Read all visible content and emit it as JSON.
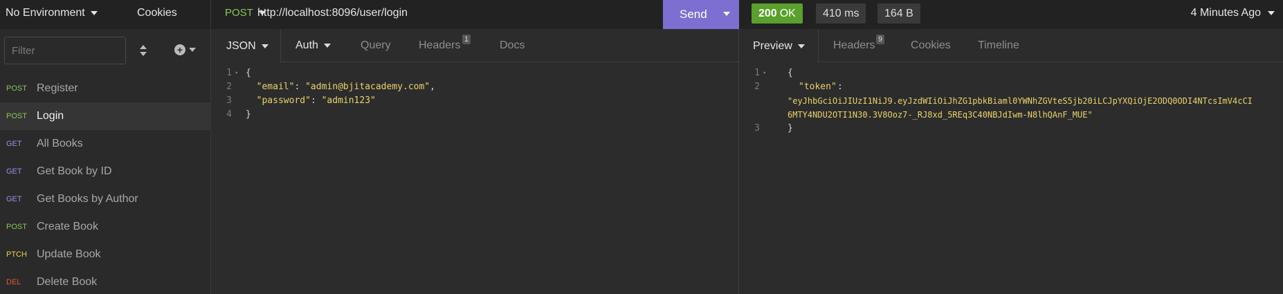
{
  "sidebar": {
    "environment": "No Environment",
    "cookies": "Cookies",
    "filter_placeholder": "Filter",
    "requests": [
      {
        "method": "POST",
        "name": "Register",
        "color": "#8ac55a",
        "active": false
      },
      {
        "method": "POST",
        "name": "Login",
        "color": "#8ac55a",
        "active": true
      },
      {
        "method": "GET",
        "name": "All Books",
        "color": "#9e8ee6",
        "active": false
      },
      {
        "method": "GET",
        "name": "Get Book by ID",
        "color": "#9e8ee6",
        "active": false
      },
      {
        "method": "GET",
        "name": "Get Books by Author",
        "color": "#9e8ee6",
        "active": false
      },
      {
        "method": "POST",
        "name": "Create Book",
        "color": "#8ac55a",
        "active": false
      },
      {
        "method": "PTCH",
        "name": "Update Book",
        "color": "#e8d24e",
        "active": false
      },
      {
        "method": "DEL",
        "name": "Delete Book",
        "color": "#e2573f",
        "active": false
      }
    ]
  },
  "request": {
    "method": "POST",
    "url": "http://localhost:8096/user/login",
    "send_label": "Send",
    "tabs": {
      "body": "JSON",
      "auth": "Auth",
      "query": "Query",
      "headers": "Headers",
      "headers_count": "1",
      "docs": "Docs"
    },
    "body_lines": [
      {
        "num": "1",
        "parts": [
          [
            "p",
            "{"
          ]
        ],
        "fold": true
      },
      {
        "num": "2",
        "parts": [
          [
            "p",
            "  "
          ],
          [
            "k",
            "\"email\""
          ],
          [
            "p",
            ": "
          ],
          [
            "s",
            "\"admin@bjitacademy.com\""
          ],
          [
            "p",
            ","
          ]
        ]
      },
      {
        "num": "3",
        "parts": [
          [
            "p",
            "  "
          ],
          [
            "k",
            "\"password\""
          ],
          [
            "p",
            ": "
          ],
          [
            "s",
            "\"admin123\""
          ]
        ]
      },
      {
        "num": "4",
        "parts": [
          [
            "p",
            "}"
          ]
        ]
      }
    ]
  },
  "response": {
    "status_code": "200",
    "status_text": "OK",
    "time": "410 ms",
    "size": "164 B",
    "ago": "4 Minutes Ago",
    "tabs": {
      "preview": "Preview",
      "headers": "Headers",
      "headers_count": "9",
      "cookies": "Cookies",
      "timeline": "Timeline"
    },
    "line_numbers": [
      "1",
      "2",
      "3"
    ],
    "open_brace": "{",
    "token_key": "\"token\"",
    "token_colon": ":",
    "token_value_line1": "\"eyJhbGciOiJIUzI1NiJ9.eyJzdWIiOiJhZG1pbkBiaml0YWNhZGVteS5jb20iLCJpYXQiOjE2ODQ0ODI4NTcsImV4cCI",
    "token_value_line2": "6MTY4NDU2OTI1N30.3V8Ooz7-_RJ8xd_5REq3C40NBJdIwm-N8lhQAnF_MUE\"",
    "close_brace": "}"
  }
}
